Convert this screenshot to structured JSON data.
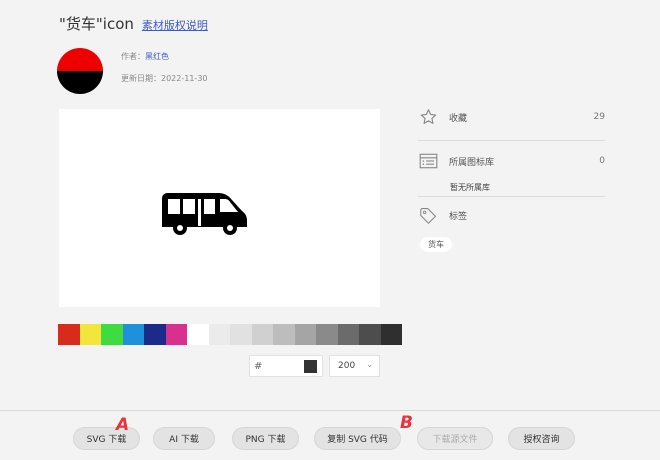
{
  "title": {
    "icon_name": "\"货车\"icon",
    "license_link": "素材版权说明"
  },
  "author": {
    "label": "作者：",
    "name": "黑红色"
  },
  "updated": {
    "label": "更新日期：",
    "date": "2022-11-30"
  },
  "palette": [
    "#d92b1c",
    "#f2e63a",
    "#3edc3e",
    "#1e90dc",
    "#1c2a8a",
    "#d8308e",
    "#ffffff",
    "#ebebeb",
    "#e1e1e1",
    "#d0d0d0",
    "#bdbdbd",
    "#a5a5a5",
    "#8a8a8a",
    "#6b6b6b",
    "#4d4d4d",
    "#2f2f2f"
  ],
  "color_input": {
    "hash": "#",
    "value": ""
  },
  "size_select": {
    "value": "200"
  },
  "sidebar": {
    "favorites": {
      "label": "收藏",
      "count": "29"
    },
    "library": {
      "label": "所属图标库",
      "count": "0",
      "empty_text": "暂无所属库"
    },
    "tags": {
      "label": "标签",
      "items": [
        "货车"
      ]
    }
  },
  "buttons": {
    "svg": "SVG 下载",
    "ai": "AI 下载",
    "png": "PNG 下载",
    "copy_svg": "复制 SVG 代码",
    "source": "下载源文件",
    "license": "授权咨询"
  },
  "annotations": {
    "a": "A",
    "b": "B"
  },
  "icons": {
    "star": "star-icon",
    "library": "folder-list-icon",
    "tag": "tag-icon",
    "preview": "van-icon"
  }
}
